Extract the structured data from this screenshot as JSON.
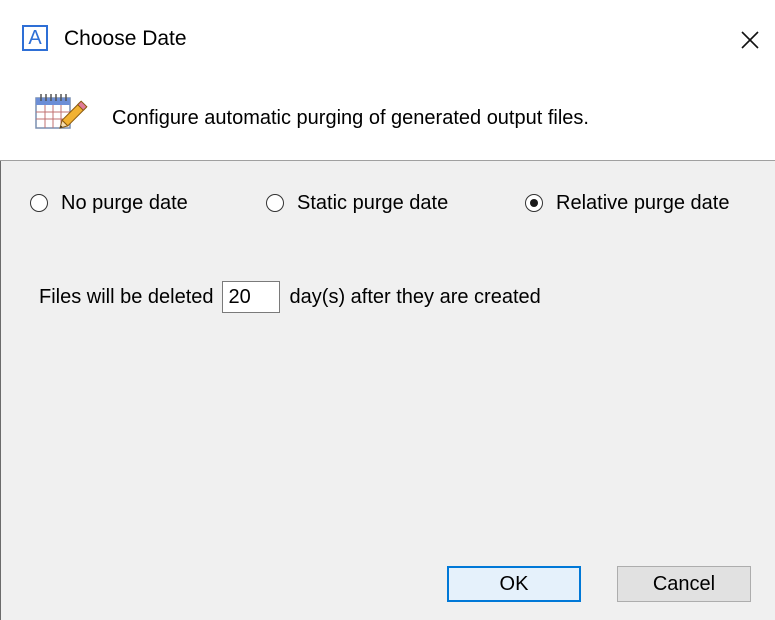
{
  "window": {
    "title": "Choose Date",
    "app_icon_letter": "A",
    "close_glyph": "close-icon"
  },
  "header": {
    "description": "Configure automatic purging of generated output files.",
    "icon": "calendar-edit-icon"
  },
  "purge_options": [
    {
      "label": "No purge date",
      "checked": false
    },
    {
      "label": "Static purge date",
      "checked": false
    },
    {
      "label": "Relative purge date",
      "checked": true
    }
  ],
  "relative": {
    "prefix": "Files will be deleted",
    "days_value": "20",
    "suffix": "day(s) after they are created"
  },
  "buttons": {
    "ok_label": "OK",
    "cancel_label": "Cancel"
  },
  "colors": {
    "accent": "#0078d7",
    "app_icon": "#2e6fd6",
    "content_bg": "#f0f0f0"
  }
}
